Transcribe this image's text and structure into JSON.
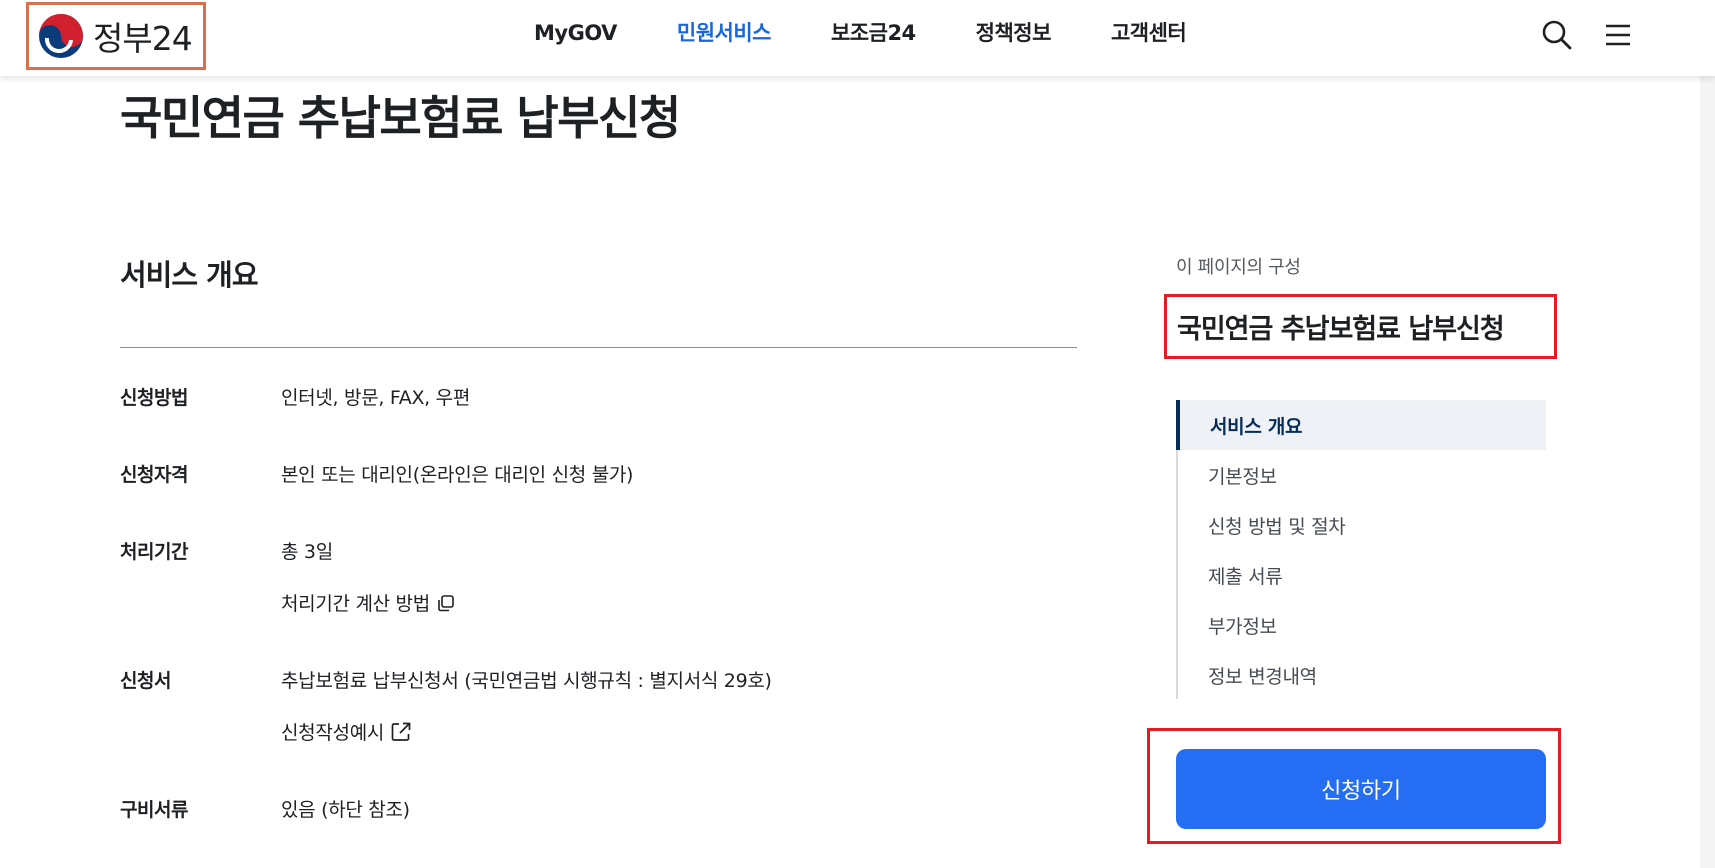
{
  "header": {
    "logo_text": "정부24",
    "nav": [
      {
        "label": "MyGOV",
        "active": false
      },
      {
        "label": "민원서비스",
        "active": true
      },
      {
        "label": "보조금24",
        "active": false
      },
      {
        "label": "정책정보",
        "active": false
      },
      {
        "label": "고객센터",
        "active": false
      }
    ],
    "icons": {
      "search": "search-icon",
      "menu": "menu-icon"
    }
  },
  "page": {
    "title": "국민연금 추납보험료 납부신청"
  },
  "overview": {
    "title": "서비스 개요",
    "rows": [
      {
        "label": "신청방법",
        "value": "인터넷, 방문, FAX, 우편"
      },
      {
        "label": "신청자격",
        "value": "본인 또는 대리인(온라인은 대리인 신청 불가)"
      },
      {
        "label": "처리기간",
        "value": "총 3일",
        "link": "처리기간 계산 방법"
      },
      {
        "label": "신청서",
        "value": "추납보험료 납부신청서 (국민연금법 시행규칙 : 별지서식 29호)",
        "link": "신청작성예시"
      },
      {
        "label": "구비서류",
        "value": "있음 (하단 참조)"
      }
    ]
  },
  "toc": {
    "caption": "이 페이지의 구성",
    "title": "국민연금 추납보험료 납부신청",
    "items": [
      {
        "label": "서비스 개요",
        "active": true
      },
      {
        "label": "기본정보",
        "active": false
      },
      {
        "label": "신청 방법 및 절차",
        "active": false
      },
      {
        "label": "제출 서류",
        "active": false
      },
      {
        "label": "부가정보",
        "active": false
      },
      {
        "label": "정보 변경내역",
        "active": false
      }
    ]
  },
  "apply_button": "신청하기",
  "colors": {
    "accent": "#256ef4",
    "nav_active": "#1967e0",
    "highlight_border": "#e31b23",
    "logo_border": "#d96f4f",
    "toc_active": "#052b57"
  }
}
